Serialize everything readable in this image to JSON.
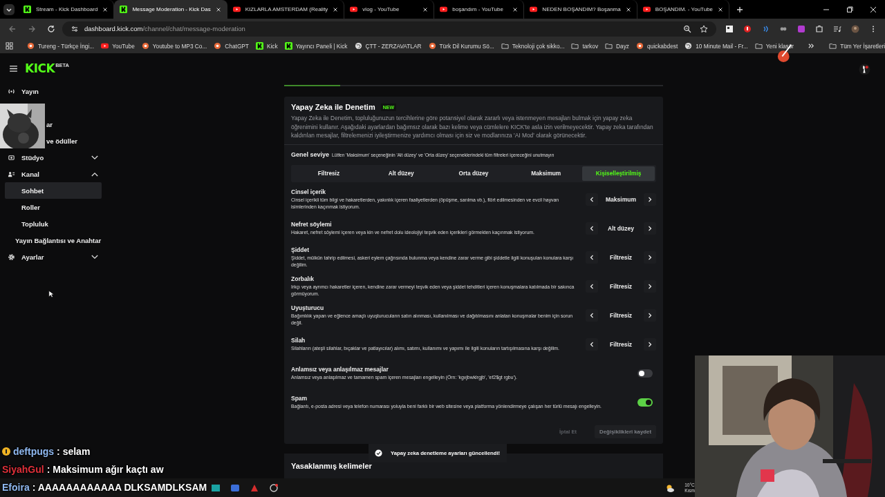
{
  "browser": {
    "tabs": [
      {
        "title": "Stream - Kick Dashboard",
        "kind": "kick",
        "selected": false
      },
      {
        "title": "Message Moderation - Kick Das",
        "kind": "kick",
        "selected": true
      },
      {
        "title": "KIZLARLA AMSTERDAM (Reality",
        "kind": "youtube",
        "selected": false
      },
      {
        "title": "vlog - YouTube",
        "kind": "youtube",
        "selected": false
      },
      {
        "title": "boşandım - YouTube",
        "kind": "youtube",
        "selected": false
      },
      {
        "title": "NEDEN BOŞANDIM? Boşanma",
        "kind": "youtube",
        "selected": false
      },
      {
        "title": "BOŞANDIM. - YouTube",
        "kind": "youtube",
        "selected": false
      }
    ],
    "url": {
      "domain": "dashboard.kick.com",
      "path": "/channel/chat/message-moderation"
    },
    "bookmarks": [
      {
        "label": "Tureng - Türkçe İngi...",
        "kind": "site"
      },
      {
        "label": "YouTube",
        "kind": "youtube"
      },
      {
        "label": "Youtube to MP3 Co...",
        "kind": "site"
      },
      {
        "label": "ChatGPT",
        "kind": "site"
      },
      {
        "label": "Kick",
        "kind": "kick"
      },
      {
        "label": "Yayıncı Paneli | Kick",
        "kind": "kick"
      },
      {
        "label": "ÇTT - ZERZAVATLAR",
        "kind": "globe"
      },
      {
        "label": "Türk Dil Kurumu Sö...",
        "kind": "site"
      },
      {
        "label": "Teknoloji çok sikko...",
        "kind": "folder"
      },
      {
        "label": "tarkov",
        "kind": "folder"
      },
      {
        "label": "Dayz",
        "kind": "folder"
      },
      {
        "label": "quickabdest",
        "kind": "site"
      },
      {
        "label": "10 Minute Mail - Fr...",
        "kind": "globe"
      },
      {
        "label": "Yeni klasör",
        "kind": "folder"
      }
    ],
    "all_bookmarks": "Tüm Yer İşaretleri"
  },
  "header": {
    "logo": "KICK",
    "beta": "BETA"
  },
  "sidebar": {
    "items": [
      {
        "label": "Yayın",
        "kind": "broadcast"
      },
      {
        "label": "ar",
        "kind": "covered"
      },
      {
        "label": "ve ödüller",
        "kind": "covered"
      },
      {
        "label": "Stüdyo",
        "kind": "camera",
        "expanded": false
      },
      {
        "label": "Kanal",
        "kind": "people",
        "expanded": true,
        "children": [
          {
            "label": "Sohbet",
            "selected": true
          },
          {
            "label": "Roller",
            "selected": false
          },
          {
            "label": "Topluluk",
            "selected": false
          }
        ]
      },
      {
        "label": "Yayın Bağlantısı ve Anahtar",
        "kind": "link"
      },
      {
        "label": "Ayarlar",
        "kind": "settings",
        "expanded": false
      }
    ]
  },
  "ai_moderation": {
    "title": "Yapay Zeka ile Denetim",
    "badge": "NEW",
    "description": "Yapay Zeka ile Denetim, topluluğunuzun tercihlerine göre potansiyel olarak zararlı veya istenmeyen mesajları bulmak için yapay zeka öğrenimini kullanır. Aşağıdaki ayarlardan bağımsız olarak bazı kelime veya cümlelere KICK'te asla izin verilmeyecektir. Yapay zeka tarafından kaldırılan mesajlar, filtrelemenizi iyileştirmenize yardımcı olması için siz ve modlarınıza 'AI Mod' olarak görünecektir.",
    "general_level": {
      "label": "Genel seviye",
      "note": "Lütfen 'Maksimum' seçeneğinin 'Alt düzey' ve 'Orta düzey' seçeneklerindeki tüm filtreleri içereceğini unutmayın"
    },
    "levels": [
      {
        "label": "Filtresiz",
        "selected": false
      },
      {
        "label": "Alt düzey",
        "selected": false
      },
      {
        "label": "Orta düzey",
        "selected": false
      },
      {
        "label": "Maksimum",
        "selected": false
      },
      {
        "label": "Kişiselleştirilmiş",
        "selected": true
      }
    ],
    "rules": [
      {
        "kind": "stepper",
        "name": "Cinsel içerik",
        "description": "Cinsel içerikli tüm bilgi ve hakaretlerden, yakınlık içeren faaliyetlerden (öpüşme, sarılma vb.), flört edilmesinden ve evcil hayvan isimlerinden kaçınmak istiyorum.",
        "value": "Maksimum"
      },
      {
        "kind": "stepper",
        "name": "Nefret söylemi",
        "description": "Hakaret, nefret söylemi içeren veya kin ve nefret dolu ideolojiyi teşvik eden içerikleri görmekten kaçınmak istiyorum.",
        "value": "Alt düzey"
      },
      {
        "kind": "stepper",
        "name": "Şiddet",
        "description": "Şiddet, mülkün tahrip edilmesi, askeri eylem çağrısında bulunma veya kendine zarar verme gibi şiddetle ilgili konuşulan konulara karşı değilim.",
        "value": "Filtresiz"
      },
      {
        "kind": "stepper",
        "name": "Zorbalık",
        "description": "Irkçı veya ayrımcı hakaretler içeren, kendine zarar vermeyi teşvik eden veya şiddet tehditleri içeren konuşmalara katılmada bir sakınca görmüyorum.",
        "value": "Filtresiz"
      },
      {
        "kind": "stepper",
        "name": "Uyuşturucu",
        "description": "Bağımlılık yapan ve eğlence amaçlı uyuşturucuların satın alınması, kullanılması ve dağıtılmasını anlatan konuşmalar benim için sorun değil.",
        "value": "Filtresiz"
      },
      {
        "kind": "stepper",
        "name": "Silah",
        "description": "Silahların (ateşli silahlar, bıçaklar ve patlayıcılar) alımı, satımı, kullanımı ve yapımı ile ilgili konuların tartışılmasına karşı değilim.",
        "value": "Filtresiz"
      },
      {
        "kind": "toggle",
        "name": "Anlamsız veya anlaşılmaz mesajlar",
        "description": "Anlamsız veya anlaşılmaz ve tamamen spam içeren mesajları engelleyin (Örn: 'kgvjbwklrgjb', 'ef2$gt rgbu').",
        "on": false
      },
      {
        "kind": "toggle",
        "name": "Spam",
        "description": "Bağlantı, e-posta adresi veya telefon numarası yoluyla beni farklı bir web sitesine veya platforma yönlendirmeye çalışan her türlü mesajı engelleyin.",
        "on": true
      }
    ],
    "cancel": {
      "label": "İptal Et",
      "disabled": true
    },
    "save": {
      "label": "Değişiklikleri kaydet",
      "disabled": true
    }
  },
  "banned_words": {
    "title": "Yasaklanmış kelimeler"
  },
  "toast": "Yapay zeka denetleme ayarları güncellendi!",
  "chat_overlay": [
    {
      "user": "deftpugs",
      "message": ": selam",
      "color": "#8fb8f0",
      "badge": true
    },
    {
      "user": "SiyahGul",
      "message": ": Maksimum ağır kaçtı aw",
      "color": "#e0303a",
      "badge": false
    },
    {
      "user": "Efoira",
      "message": ": AAAAAAAAAAAA DLKSAMDLKSAM",
      "color": "#8fb8f0",
      "badge": false
    }
  ],
  "taskbar": {
    "temperature": "10°C",
    "weather": "Kısm"
  }
}
